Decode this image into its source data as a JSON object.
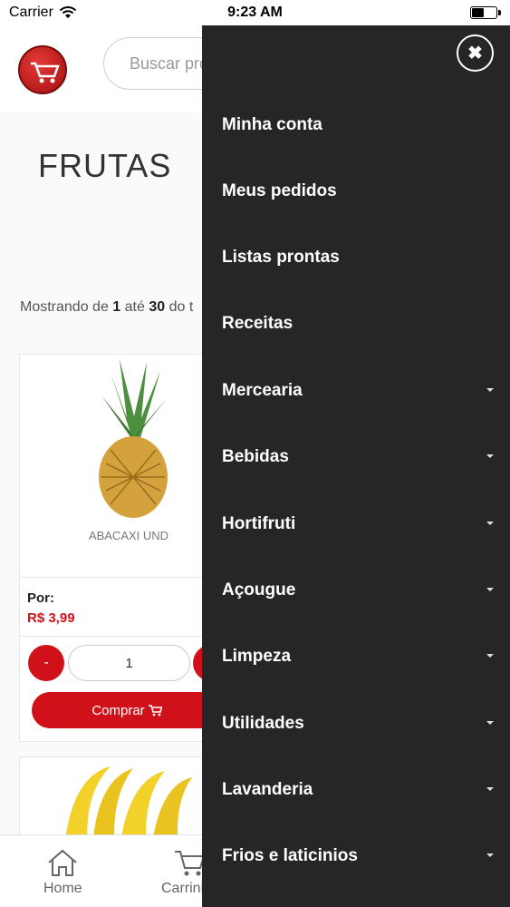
{
  "status_bar": {
    "carrier": "Carrier",
    "time": "9:23 AM"
  },
  "header": {
    "search_placeholder": "Buscar produtos"
  },
  "page": {
    "title": "FRUTAS",
    "results_prefix": "Mostrando de ",
    "results_from": "1",
    "results_mid": " até ",
    "results_to": "30",
    "results_suffix": " do t"
  },
  "products": [
    {
      "name": "ABACAXI UND",
      "price_label": "Por:",
      "price": "R$ 3,99",
      "minus_label": "-",
      "quantity": "1",
      "buy_label": "Comprar"
    }
  ],
  "bottom_nav": {
    "home_label": "Home",
    "cart_label": "Carrinho"
  },
  "drawer": {
    "items": [
      {
        "label": "Minha conta"
      },
      {
        "label": "Meus pedidos"
      },
      {
        "label": "Listas prontas"
      },
      {
        "label": "Receitas"
      },
      {
        "label": "Mercearia"
      },
      {
        "label": "Bebidas"
      },
      {
        "label": "Hortifruti"
      },
      {
        "label": "Açougue"
      },
      {
        "label": "Limpeza"
      },
      {
        "label": "Utilidades"
      },
      {
        "label": "Lavanderia"
      },
      {
        "label": "Frios e laticinios"
      }
    ]
  },
  "colors": {
    "accent": "#d0111a",
    "drawer_bg": "#262527"
  }
}
